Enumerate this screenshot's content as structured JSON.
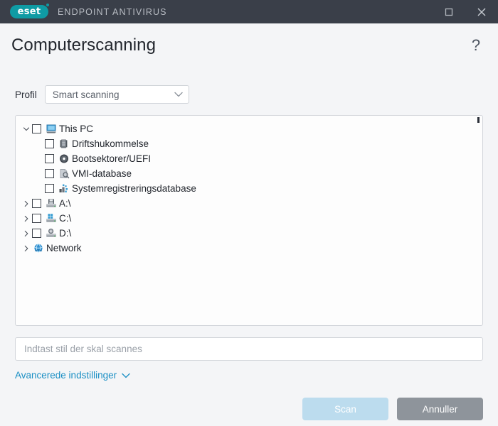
{
  "titlebar": {
    "logo_text": "eset",
    "product_name": "ENDPOINT ANTIVIRUS",
    "maximize_label": "Maximize",
    "close_label": "Close",
    "background_color": "#3a3f49",
    "logo_color": "#0f9ba4"
  },
  "header": {
    "title": "Computerscanning",
    "help_glyph": "?"
  },
  "profile": {
    "label": "Profil",
    "selected": "Smart scanning",
    "options": [
      "Smart scanning"
    ]
  },
  "tree": {
    "items": [
      {
        "label": "This PC",
        "level": 0,
        "twisty": "expanded",
        "checkbox": true,
        "checked": false,
        "icon": "monitor-icon"
      },
      {
        "label": "Driftshukommelse",
        "level": 1,
        "twisty": "none",
        "checkbox": true,
        "checked": false,
        "icon": "memory-icon"
      },
      {
        "label": "Bootsektorer/UEFI",
        "level": 1,
        "twisty": "none",
        "checkbox": true,
        "checked": false,
        "icon": "disc-icon"
      },
      {
        "label": "VMI-database",
        "level": 1,
        "twisty": "none",
        "checkbox": true,
        "checked": false,
        "icon": "wmi-database-icon"
      },
      {
        "label": "Systemregistreringsdatabase",
        "level": 1,
        "twisty": "none",
        "checkbox": true,
        "checked": false,
        "icon": "registry-icon"
      },
      {
        "label": "A:\\",
        "level": 0,
        "twisty": "collapsed",
        "checkbox": true,
        "checked": false,
        "icon": "floppy-drive-icon"
      },
      {
        "label": "C:\\",
        "level": 0,
        "twisty": "collapsed",
        "checkbox": true,
        "checked": false,
        "icon": "hard-drive-icon"
      },
      {
        "label": "D:\\",
        "level": 0,
        "twisty": "collapsed",
        "checkbox": true,
        "checked": false,
        "icon": "optical-drive-icon"
      },
      {
        "label": "Network",
        "level": 0,
        "twisty": "collapsed",
        "checkbox": false,
        "checked": false,
        "icon": "network-globe-icon"
      }
    ]
  },
  "path_field": {
    "value": "",
    "placeholder": "Indtast stil der skal scannes"
  },
  "advanced": {
    "label": "Avancerede indstillinger",
    "link_color": "#1a8fc4"
  },
  "footer": {
    "scan_label": "Scan",
    "cancel_label": "Annuller",
    "scan_color": "#bcdcee",
    "cancel_color": "#8e949b"
  }
}
